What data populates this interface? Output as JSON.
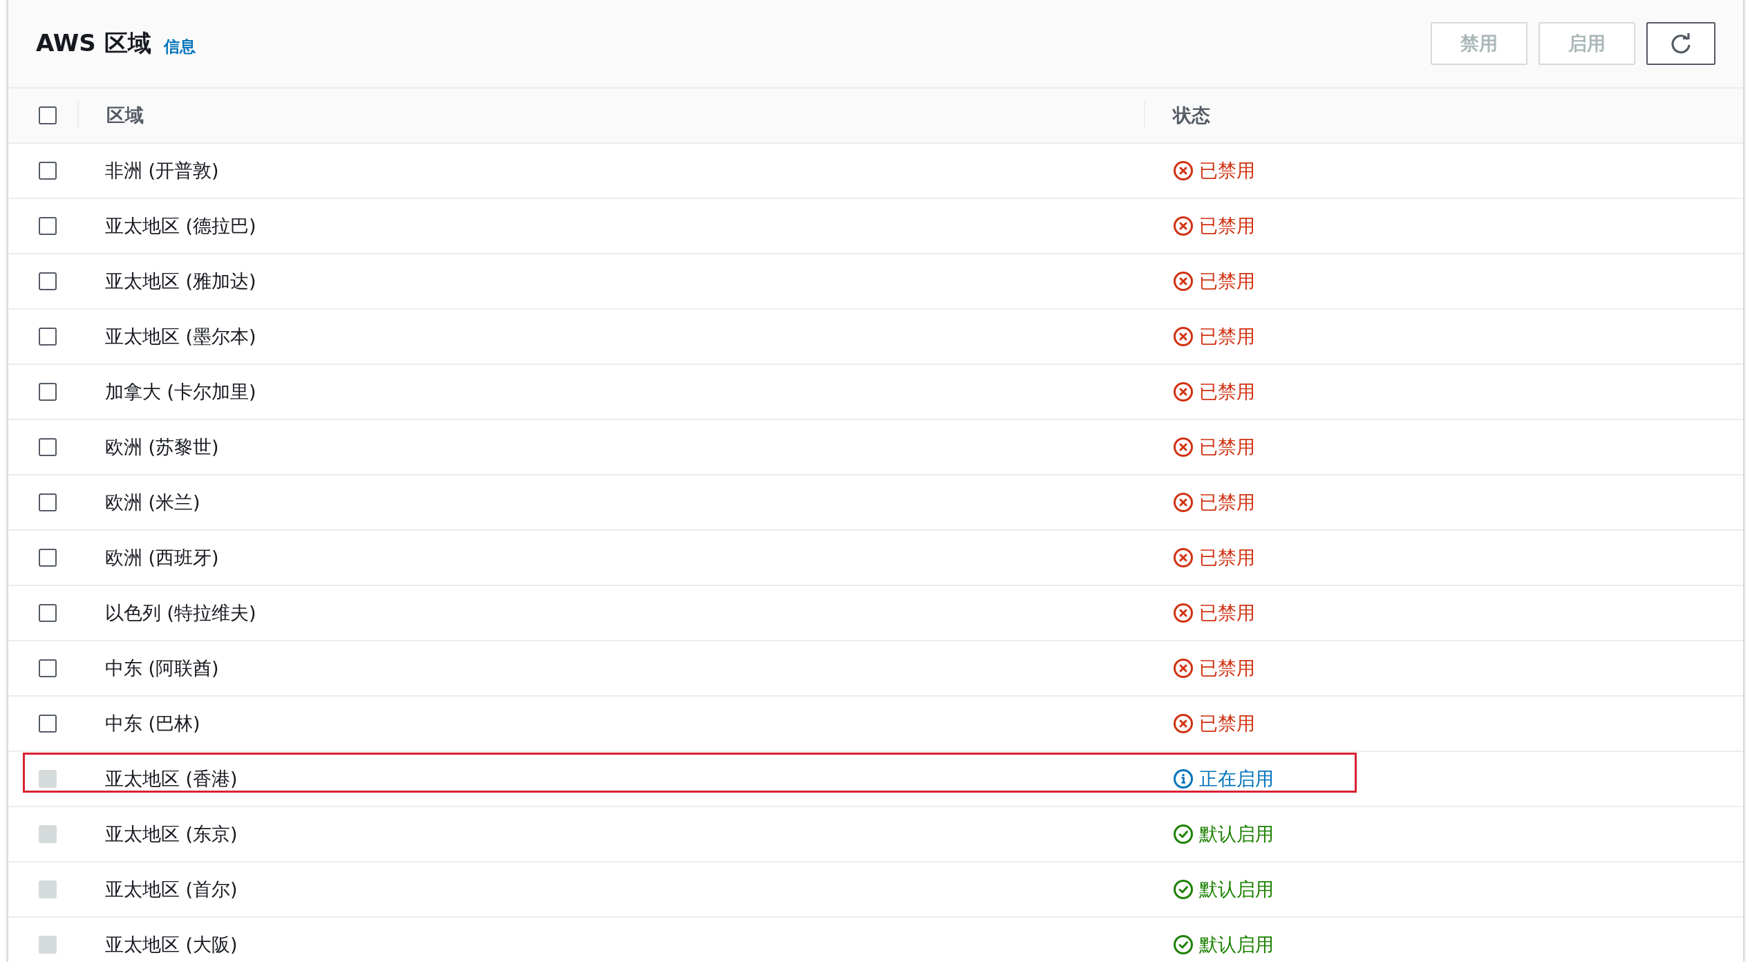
{
  "header": {
    "title": "AWS 区域",
    "info_link": "信息",
    "buttons": [
      {
        "kind": "text",
        "label": "禁用",
        "disabled": true
      },
      {
        "kind": "text",
        "label": "启用",
        "disabled": true
      },
      {
        "kind": "refresh",
        "disabled": false
      }
    ]
  },
  "table": {
    "select_all": {
      "checked": false,
      "disabled": false
    },
    "columns": [
      "区域",
      "状态"
    ],
    "rows": [
      {
        "region": "非洲 (开普敦)",
        "status": "已禁用",
        "kind": "disabled",
        "checked": false,
        "disabled": false,
        "highlighted": false
      },
      {
        "region": "亚太地区 (德拉巴)",
        "status": "已禁用",
        "kind": "disabled",
        "checked": false,
        "disabled": false,
        "highlighted": false
      },
      {
        "region": "亚太地区 (雅加达)",
        "status": "已禁用",
        "kind": "disabled",
        "checked": false,
        "disabled": false,
        "highlighted": false
      },
      {
        "region": "亚太地区 (墨尔本)",
        "status": "已禁用",
        "kind": "disabled",
        "checked": false,
        "disabled": false,
        "highlighted": false
      },
      {
        "region": "加拿大 (卡尔加里)",
        "status": "已禁用",
        "kind": "disabled",
        "checked": false,
        "disabled": false,
        "highlighted": false
      },
      {
        "region": "欧洲 (苏黎世)",
        "status": "已禁用",
        "kind": "disabled",
        "checked": false,
        "disabled": false,
        "highlighted": false
      },
      {
        "region": "欧洲 (米兰)",
        "status": "已禁用",
        "kind": "disabled",
        "checked": false,
        "disabled": false,
        "highlighted": false
      },
      {
        "region": "欧洲 (西班牙)",
        "status": "已禁用",
        "kind": "disabled",
        "checked": false,
        "disabled": false,
        "highlighted": false
      },
      {
        "region": "以色列 (特拉维夫)",
        "status": "已禁用",
        "kind": "disabled",
        "checked": false,
        "disabled": false,
        "highlighted": false
      },
      {
        "region": "中东 (阿联酋)",
        "status": "已禁用",
        "kind": "disabled",
        "checked": false,
        "disabled": false,
        "highlighted": false
      },
      {
        "region": "中东 (巴林)",
        "status": "已禁用",
        "kind": "disabled",
        "checked": false,
        "disabled": false,
        "highlighted": false
      },
      {
        "region": "亚太地区 (香港)",
        "status": "正在启用",
        "kind": "enabling",
        "checked": false,
        "disabled": true,
        "highlighted": true
      },
      {
        "region": "亚太地区 (东京)",
        "status": "默认启用",
        "kind": "default",
        "checked": false,
        "disabled": true,
        "highlighted": false
      },
      {
        "region": "亚太地区 (首尔)",
        "status": "默认启用",
        "kind": "default",
        "checked": false,
        "disabled": true,
        "highlighted": false
      },
      {
        "region": "亚太地区 (大阪)",
        "status": "默认启用",
        "kind": "default",
        "checked": false,
        "disabled": true,
        "highlighted": false
      }
    ]
  }
}
